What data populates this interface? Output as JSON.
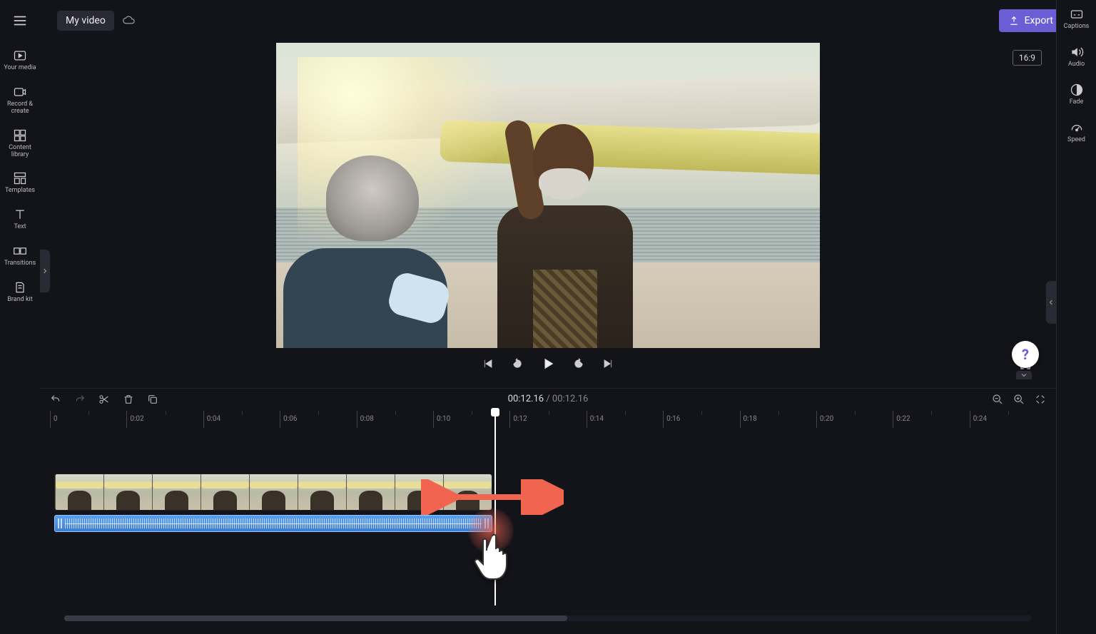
{
  "header": {
    "project_title": "My video",
    "export_label": "Export"
  },
  "preview": {
    "aspect_ratio": "16:9",
    "current_time": "00:12.16",
    "total_time": "00:12.16"
  },
  "left_rail": {
    "items": [
      {
        "label": "Your media",
        "icon": "media-icon"
      },
      {
        "label": "Record & create",
        "icon": "record-icon"
      },
      {
        "label": "Content library",
        "icon": "library-icon"
      },
      {
        "label": "Templates",
        "icon": "templates-icon"
      },
      {
        "label": "Text",
        "icon": "text-icon"
      },
      {
        "label": "Transitions",
        "icon": "transitions-icon"
      },
      {
        "label": "Brand kit",
        "icon": "brandkit-icon"
      }
    ]
  },
  "right_rail": {
    "items": [
      {
        "label": "Captions",
        "icon": "captions-icon"
      },
      {
        "label": "Audio",
        "icon": "audio-icon"
      },
      {
        "label": "Fade",
        "icon": "fade-icon"
      },
      {
        "label": "Speed",
        "icon": "speed-icon"
      }
    ]
  },
  "ruler": {
    "ticks": [
      "0",
      "0:02",
      "0:04",
      "0:06",
      "0:08",
      "0:10",
      "0:12",
      "0:14",
      "0:16",
      "0:18",
      "0:20",
      "0:22",
      "0:24"
    ]
  },
  "help": {
    "symbol": "?"
  },
  "colors": {
    "accent": "#6b5dd3",
    "audio_track": "#4a8de0",
    "drag_arrow": "#f06450"
  }
}
